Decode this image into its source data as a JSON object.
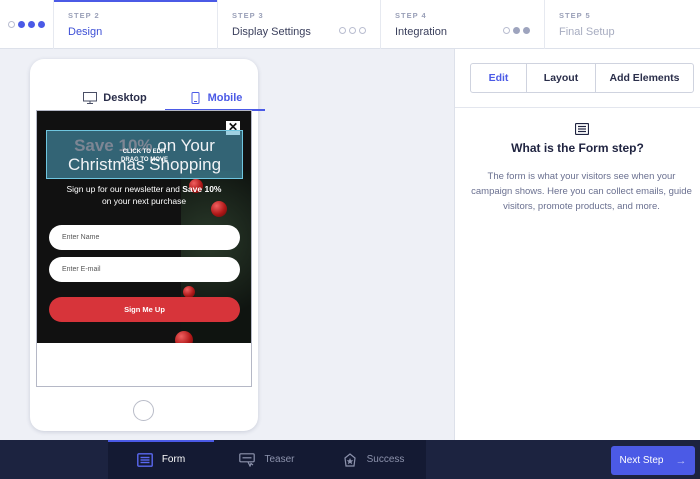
{
  "steps": [
    {
      "num": "STEP 2",
      "title": "Design",
      "state": "active"
    },
    {
      "num": "STEP 3",
      "title": "Display Settings",
      "state": "normal"
    },
    {
      "num": "STEP 4",
      "title": "Integration",
      "state": "normal"
    },
    {
      "num": "STEP 5",
      "title": "Final Setup",
      "state": "disabled"
    }
  ],
  "preview": {
    "tabs": {
      "desktop": "Desktop",
      "mobile": "Mobile"
    },
    "popup": {
      "headline_bold": "Save 10%",
      "headline_rest": " on Your",
      "headline_line2": "Christmas Shopping",
      "drag_hint_line1": "CLICK TO EDIT",
      "drag_hint_line2": "DRAG TO MOVE",
      "desc_prefix": "Sign up for our newsletter and ",
      "desc_bold": "Save 10%",
      "desc_suffix": "on your next purchase",
      "name_placeholder": "Enter Name",
      "email_placeholder": "Enter E-mail",
      "cta": "Sign Me Up",
      "close": "✕"
    }
  },
  "panel": {
    "tabs": {
      "edit": "Edit",
      "layout": "Layout",
      "add": "Add Elements"
    },
    "icon": "form-icon",
    "title": "What is the Form step?",
    "text": "The form is what your visitors see when your campaign shows. Here you can collect emails, guide visitors, promote products, and more."
  },
  "bottom": {
    "tabs": {
      "form": "Form",
      "teaser": "Teaser",
      "success": "Success"
    },
    "next": "Next Step",
    "next_arrow": "→"
  },
  "colors": {
    "accent": "#4b5ae6",
    "cta": "#d7343a",
    "bottom_bar": "#1c2340"
  }
}
